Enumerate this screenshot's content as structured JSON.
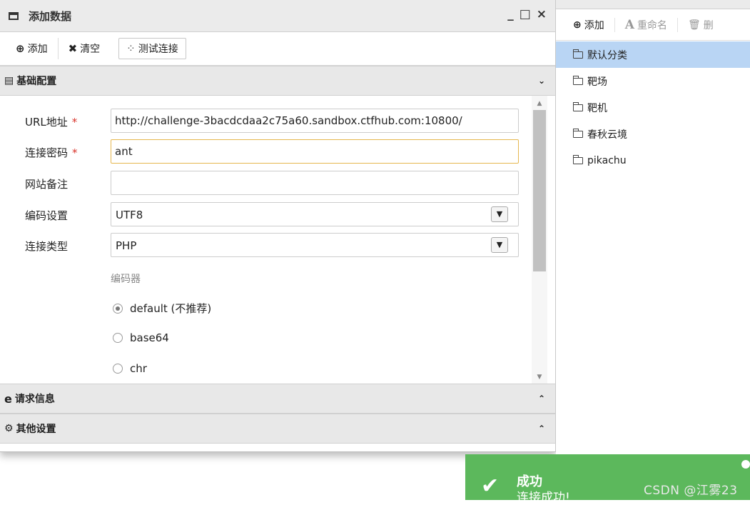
{
  "dialog": {
    "title": "添加数据",
    "controls": [
      "_",
      "□",
      "×"
    ],
    "toolbar": {
      "add_label": "添加",
      "clear_label": "清空",
      "test_label": "测试连接"
    },
    "panels": {
      "basic": "基础配置",
      "request": "请求信息",
      "other": "其他设置"
    },
    "form": {
      "url_label": "URL地址",
      "url_value": "http://challenge-3bacdcdaa2c75a60.sandbox.ctfhub.com:10800/",
      "password_label": "连接密码",
      "password_value": "ant",
      "note_label": "网站备注",
      "note_value": "",
      "encoding_label": "编码设置",
      "encoding_value": "UTF8",
      "type_label": "连接类型",
      "type_value": "PHP",
      "required_mark": "*",
      "encoder_label": "编码器",
      "encoders": [
        {
          "label": "default (不推荐)",
          "checked": true
        },
        {
          "label": "base64",
          "checked": false
        },
        {
          "label": "chr",
          "checked": false
        }
      ]
    }
  },
  "right_panel": {
    "toolbar": {
      "add_label": "添加",
      "rename_label": "重命名",
      "delete_label": "删"
    },
    "tree": [
      {
        "label": "默认分类",
        "selected": true
      },
      {
        "label": "靶场",
        "selected": false
      },
      {
        "label": "靶机",
        "selected": false
      },
      {
        "label": "春秋云境",
        "selected": false
      },
      {
        "label": "pikachu",
        "selected": false
      }
    ]
  },
  "toast": {
    "title": "成功",
    "message": "连接成功!",
    "color": "#5cb85c"
  },
  "watermark": "CSDN @江雾23"
}
